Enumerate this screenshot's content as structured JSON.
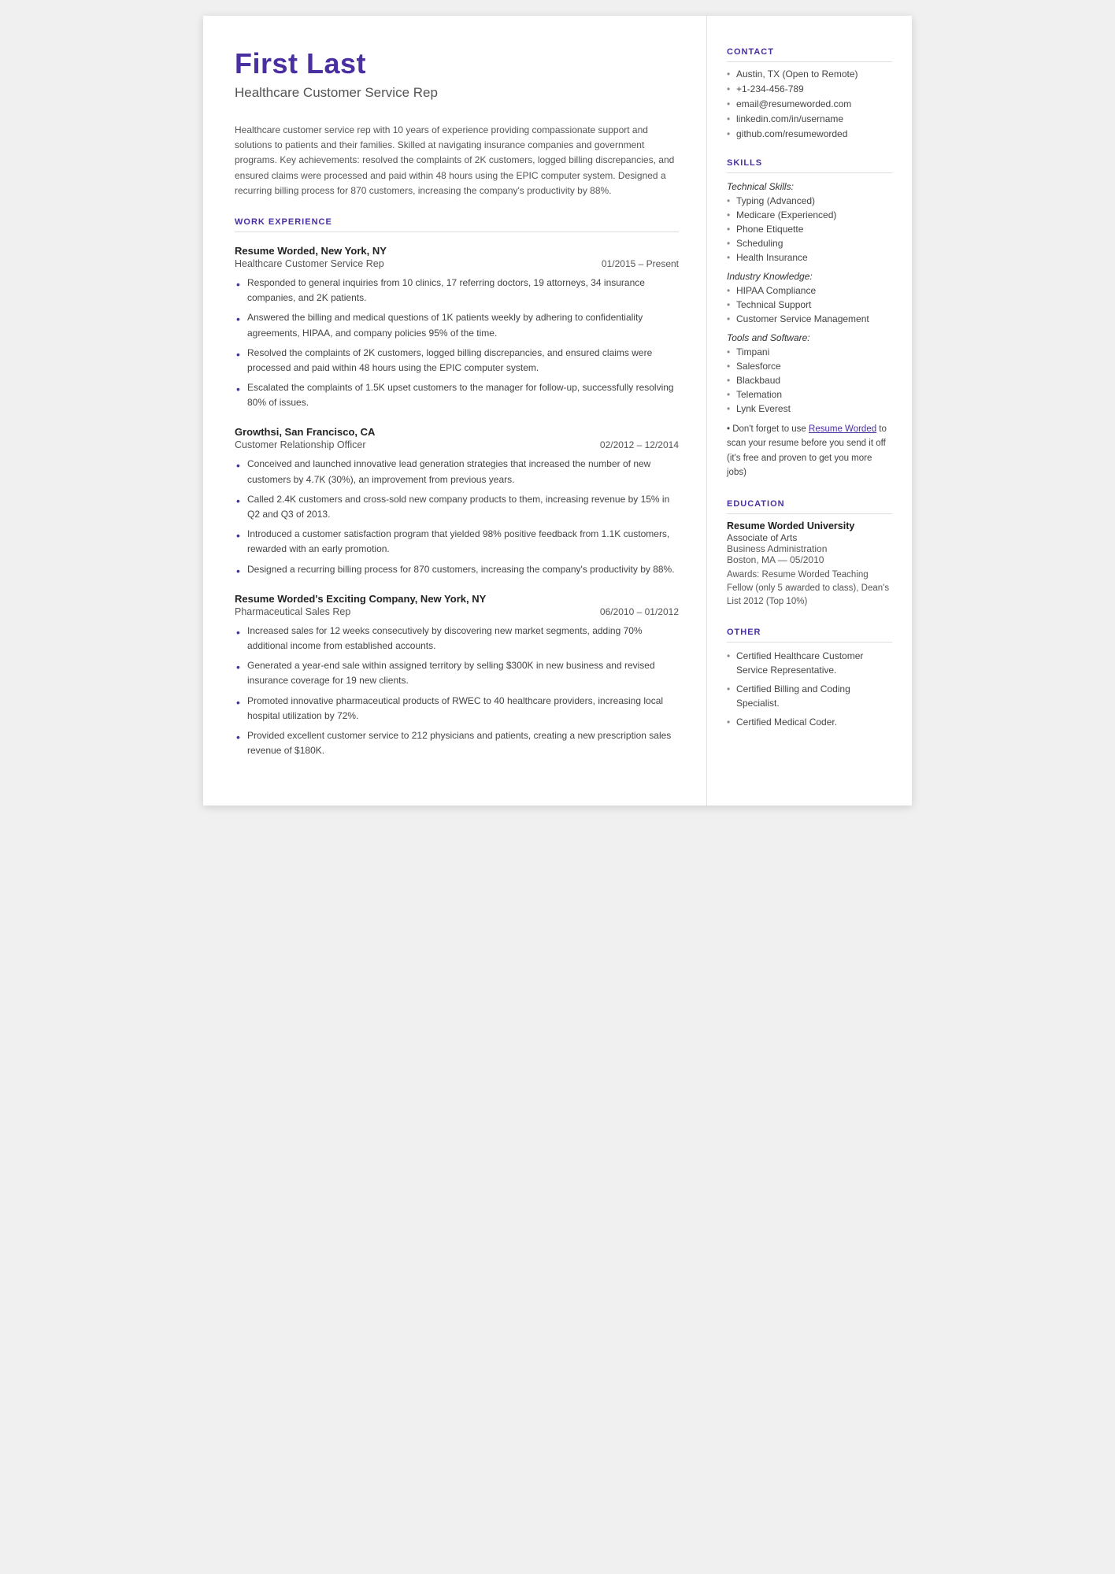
{
  "header": {
    "name": "First Last",
    "job_title": "Healthcare Customer Service Rep",
    "summary": "Healthcare customer service rep with 10 years of experience providing compassionate support and solutions to patients and their families. Skilled at navigating insurance companies and government programs. Key achievements: resolved the complaints of 2K customers, logged billing discrepancies, and ensured claims were processed and paid within 48 hours using the EPIC computer system. Designed a recurring billing process for 870 customers, increasing the company's productivity by 88%."
  },
  "sections": {
    "work_experience_label": "WORK EXPERIENCE",
    "skills_label": "SKILLS",
    "contact_label": "CONTACT",
    "education_label": "EDUCATION",
    "other_label": "OTHER"
  },
  "work_experience": [
    {
      "company": "Resume Worded, New York, NY",
      "role": "Healthcare Customer Service Rep",
      "dates": "01/2015 – Present",
      "bullets": [
        "Responded to general inquiries from 10 clinics, 17 referring doctors, 19 attorneys, 34 insurance companies, and 2K patients.",
        "Answered the billing and medical questions of 1K patients weekly by adhering to confidentiality agreements, HIPAA, and company policies 95% of the time.",
        "Resolved the complaints of 2K customers, logged billing discrepancies, and ensured claims were processed and paid within 48 hours using the EPIC computer system.",
        "Escalated the complaints of 1.5K upset customers to the manager for follow-up, successfully resolving 80% of issues."
      ]
    },
    {
      "company": "Growthsi, San Francisco, CA",
      "role": "Customer Relationship Officer",
      "dates": "02/2012 – 12/2014",
      "bullets": [
        "Conceived and launched innovative lead generation strategies that increased the number of new customers by 4.7K (30%), an improvement from previous years.",
        "Called 2.4K customers and cross-sold new company products to them, increasing revenue by 15% in Q2 and Q3 of 2013.",
        "Introduced a customer satisfaction program that yielded 98% positive feedback from 1.1K customers, rewarded with an early promotion.",
        "Designed a recurring billing process for 870 customers, increasing the company's productivity by 88%."
      ]
    },
    {
      "company": "Resume Worded's Exciting Company, New York, NY",
      "role": "Pharmaceutical Sales Rep",
      "dates": "06/2010 – 01/2012",
      "bullets": [
        "Increased sales for 12 weeks consecutively by discovering new market segments, adding 70% additional income from established accounts.",
        "Generated a year-end sale within assigned territory by selling $300K in new business and revised insurance coverage for 19 new clients.",
        "Promoted innovative pharmaceutical products of RWEC to 40 healthcare providers, increasing local hospital utilization by 72%.",
        "Provided excellent customer service to 212 physicians and patients, creating a new prescription sales revenue of $180K."
      ]
    }
  ],
  "contact": {
    "items": [
      "Austin, TX (Open to Remote)",
      "+1-234-456-789",
      "email@resumeworded.com",
      "linkedin.com/in/username",
      "github.com/resumeworded"
    ]
  },
  "skills": {
    "technical_label": "Technical Skills:",
    "technical_items": [
      "Typing (Advanced)",
      "Medicare (Experienced)",
      "Phone Etiquette",
      "Scheduling",
      "Health Insurance"
    ],
    "industry_label": "Industry Knowledge:",
    "industry_items": [
      "HIPAA Compliance",
      "Technical Support",
      "Customer Service Management"
    ],
    "tools_label": "Tools and Software:",
    "tools_items": [
      "Timpani",
      "Salesforce",
      "Blackbaud",
      "Telemation",
      "Lynk Everest"
    ],
    "rw_note": "Don't forget to use Resume Worded to scan your resume before you send it off (it's free and proven to get you more jobs)",
    "rw_link_text": "Resume Worded"
  },
  "education": [
    {
      "school": "Resume Worded University",
      "degree": "Associate of Arts",
      "field": "Business Administration",
      "location": "Boston, MA",
      "date": "05/2010",
      "awards": "Awards: Resume Worded Teaching Fellow (only 5 awarded to class), Dean's List 2012 (Top 10%)"
    }
  ],
  "other": [
    "Certified Healthcare Customer Service Representative.",
    "Certified Billing and Coding Specialist.",
    "Certified Medical Coder."
  ]
}
